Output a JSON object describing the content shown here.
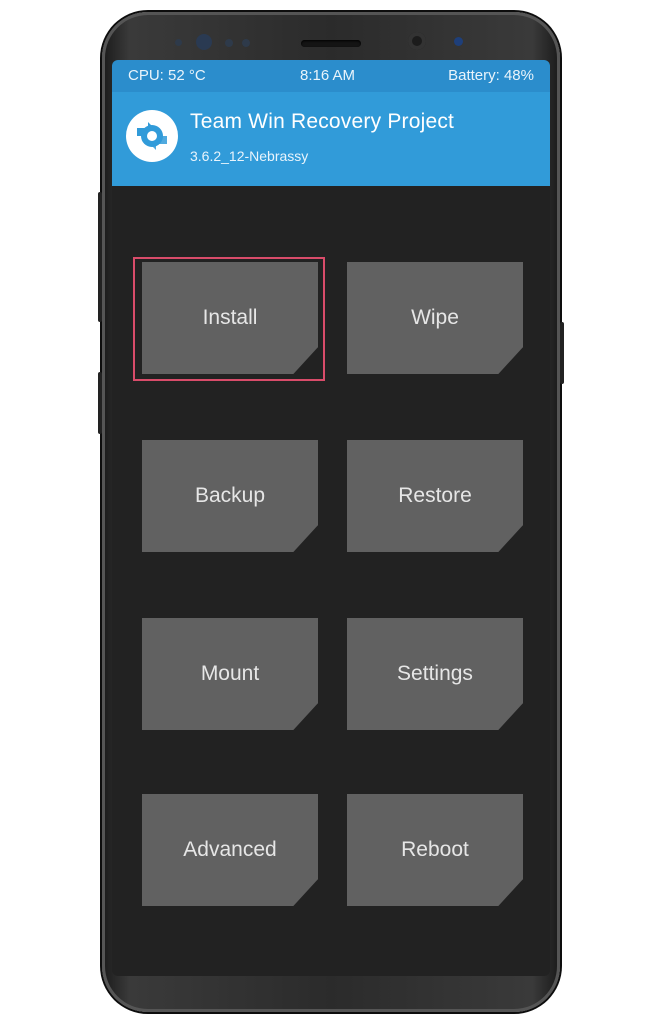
{
  "status_bar": {
    "cpu": "CPU: 52 °C",
    "time": "8:16 AM",
    "battery": "Battery: 48%"
  },
  "header": {
    "title": "Team Win Recovery Project",
    "version": "3.6.2_12-Nebrassy",
    "logo_icon": "twrp-logo-icon"
  },
  "menu": {
    "install": "Install",
    "wipe": "Wipe",
    "backup": "Backup",
    "restore": "Restore",
    "mount": "Mount",
    "settings": "Settings",
    "advanced": "Advanced",
    "reboot": "Reboot"
  },
  "highlighted_item": "Install",
  "colors": {
    "header_blue": "#319bd9",
    "status_blue": "#2b8dcc",
    "tile_gray": "#616161",
    "screen_bg": "#222222",
    "highlight": "#d94c6a"
  }
}
